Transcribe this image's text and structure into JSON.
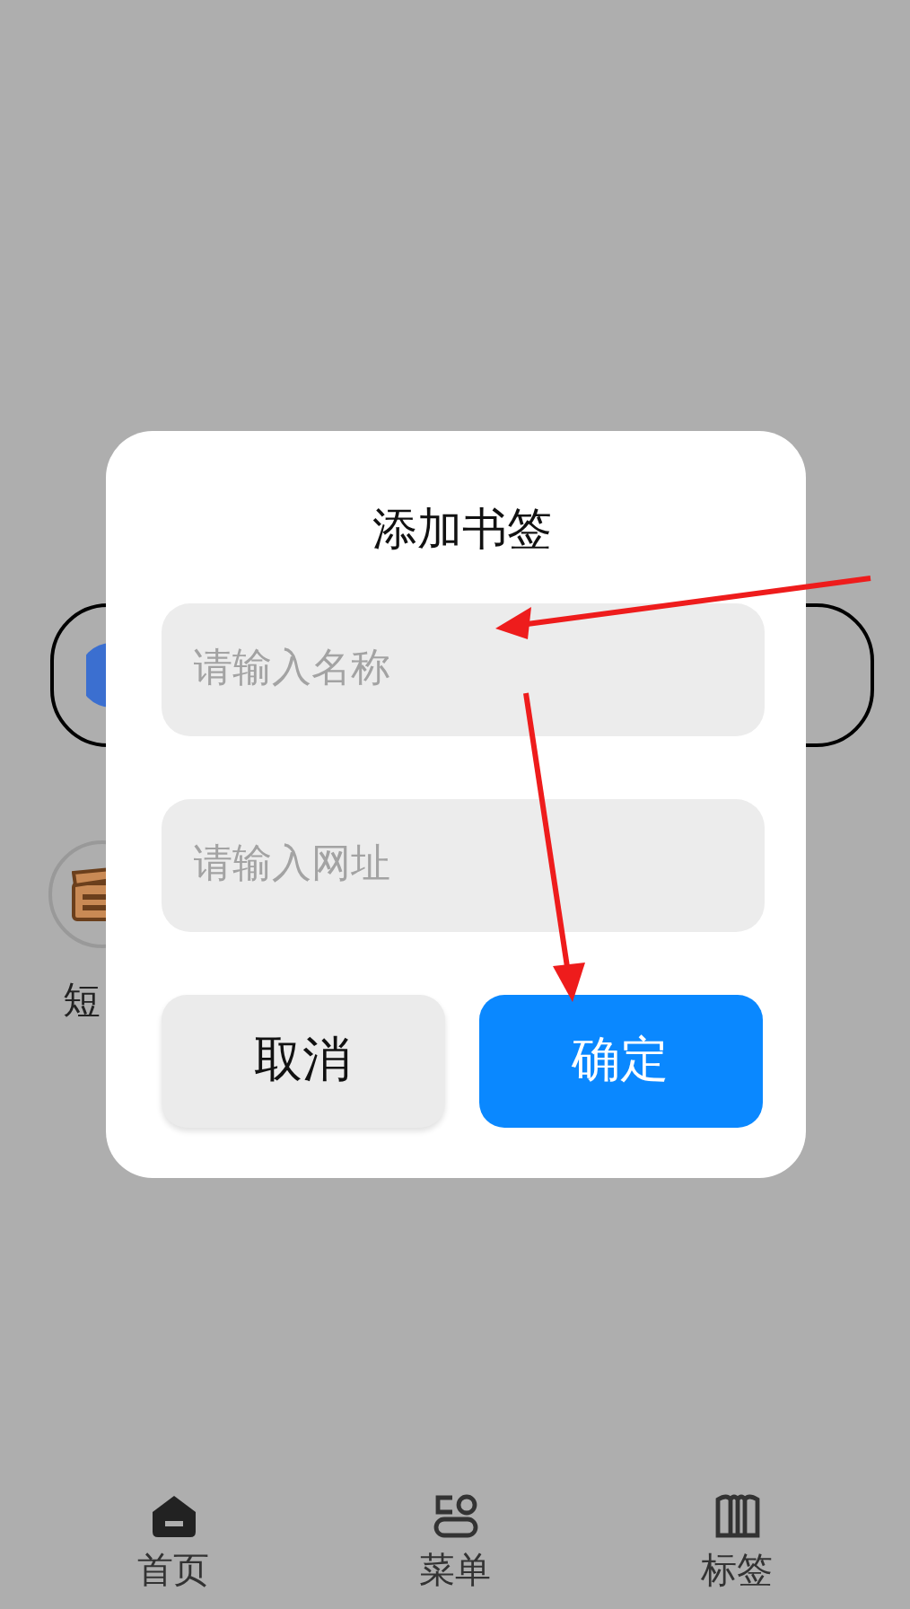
{
  "background": {
    "shortcut": {
      "label": "短"
    }
  },
  "dialog": {
    "title": "添加书签",
    "fields": [
      {
        "placeholder": "请输入名称"
      },
      {
        "placeholder": "请输入网址"
      }
    ],
    "buttons": [
      {
        "label": "取消",
        "kind": "secondary"
      },
      {
        "label": "确定",
        "kind": "primary"
      }
    ]
  },
  "nav": [
    {
      "label": "首页",
      "kind": "home",
      "selected": true
    },
    {
      "label": "菜单",
      "kind": "menu",
      "selected": false
    },
    {
      "label": "标签",
      "kind": "bookmarks",
      "selected": false
    }
  ]
}
